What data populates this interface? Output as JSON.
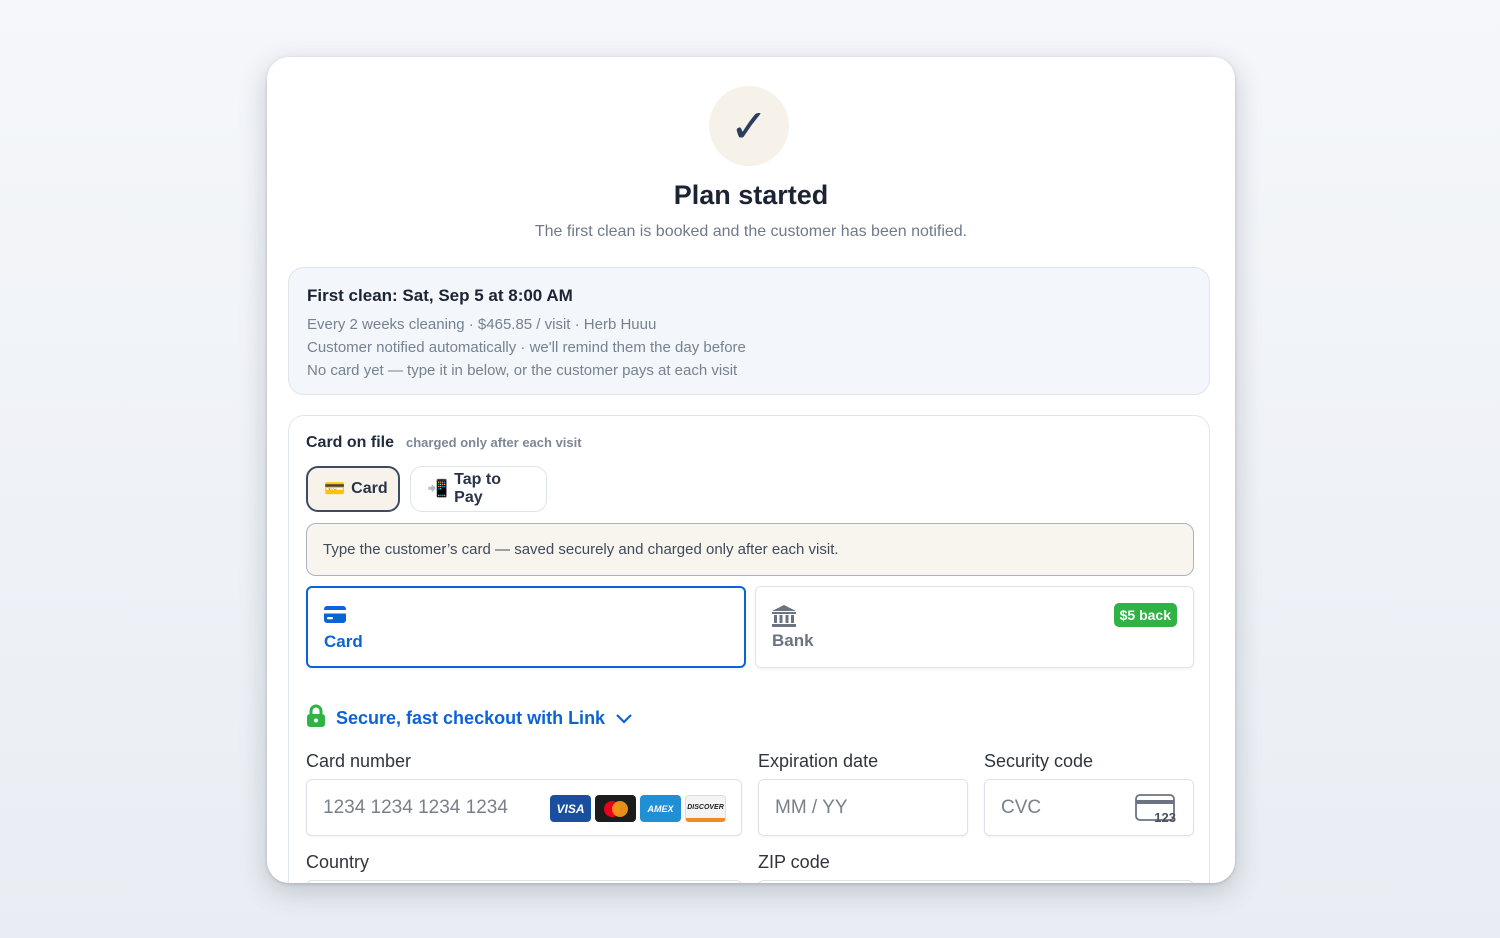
{
  "success": {
    "check_glyph": "✓",
    "title": "Plan started",
    "subtitle": "The first clean is booked and the customer has been notified."
  },
  "summary": {
    "heading": "First clean: Sat, Sep 5 at 8:00 AM",
    "lines": [
      "Every 2 weeks cleaning · $465.85 / visit · Herb Huuu",
      "Customer notified automatically · we'll remind them the day before",
      "No card yet — type it in below, or the customer pays at each visit"
    ]
  },
  "card_on_file": {
    "heading": "Card on file",
    "subheading": "charged only after each visit",
    "method_tabs": [
      {
        "icon": "credit-card-emoji-icon",
        "glyph": "💳",
        "label": "Card",
        "active": true
      },
      {
        "icon": "tap-phone-icon",
        "glyph": "📲",
        "label": "Tap to Pay",
        "active": false
      }
    ],
    "notice": "Type the customer’s card — saved securely and charged only after each visit."
  },
  "payment_types": [
    {
      "icon": "card-icon",
      "label": "Card",
      "active": true
    },
    {
      "icon": "bank-icon",
      "label": "Bank",
      "active": false,
      "badge": "$5 back"
    }
  ],
  "link": {
    "label": "Secure, fast checkout with Link",
    "icon": "lock-icon"
  },
  "form": {
    "card_number": {
      "label": "Card number",
      "placeholder": "1234 1234 1234 1234"
    },
    "brands": [
      "VISA",
      "mastercard",
      "AMEX",
      "DISCOVER"
    ],
    "expiration": {
      "label": "Expiration date",
      "placeholder": "MM / YY"
    },
    "security": {
      "label": "Security code",
      "placeholder": "CVC",
      "icon_text": "123"
    },
    "country": {
      "label": "Country"
    },
    "zip": {
      "label": "ZIP code"
    }
  },
  "colors": {
    "accent_blue": "#0b64d6",
    "badge_green": "#2fb344",
    "lock_green": "#2fb344",
    "check_navy": "#2b3e5c"
  }
}
